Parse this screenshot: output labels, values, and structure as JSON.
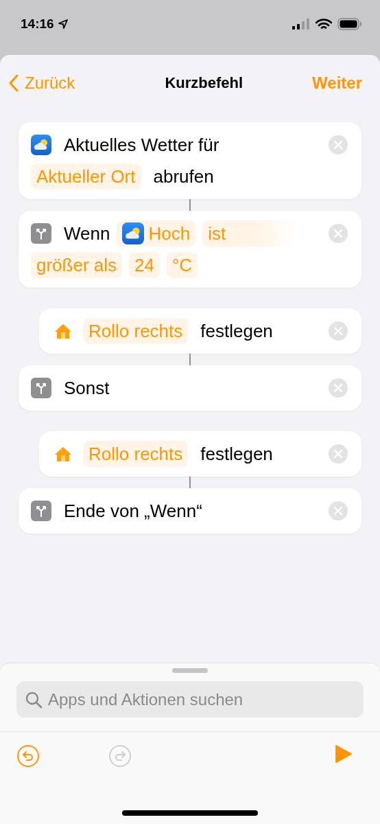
{
  "status_bar": {
    "time": "14:16"
  },
  "nav": {
    "back": "Zurück",
    "title": "Kurzbefehl",
    "next": "Weiter"
  },
  "actions": [
    {
      "kind": "weather",
      "parts": [
        {
          "kind": "word",
          "text": "Aktuelles Wetter für"
        },
        {
          "kind": "token",
          "text": "Aktueller Ort"
        },
        {
          "kind": "word",
          "text": "abrufen"
        }
      ]
    },
    {
      "kind": "if",
      "parts": [
        {
          "kind": "word",
          "text": "Wenn"
        },
        {
          "kind": "weather-token",
          "text": "Hoch"
        },
        {
          "kind": "fading-token",
          "text": "ist"
        },
        {
          "kind": "token",
          "text": "größer als"
        },
        {
          "kind": "token",
          "text": "24"
        },
        {
          "kind": "token",
          "text": "°C"
        }
      ],
      "children": [
        {
          "kind": "home",
          "parts": [
            {
              "kind": "token",
              "text": "Rollo rechts"
            },
            {
              "kind": "word",
              "text": "festlegen"
            }
          ]
        }
      ]
    },
    {
      "kind": "if",
      "parts": [
        {
          "kind": "word",
          "text": "Sonst"
        }
      ],
      "children": [
        {
          "kind": "home",
          "parts": [
            {
              "kind": "token",
              "text": "Rollo rechts"
            },
            {
              "kind": "word",
              "text": "festlegen"
            }
          ]
        }
      ]
    },
    {
      "kind": "if",
      "parts": [
        {
          "kind": "word",
          "text": "Ende von „Wenn“"
        }
      ]
    }
  ],
  "search": {
    "placeholder": "Apps und Aktionen suchen"
  },
  "toolbar": {
    "undo": {
      "disabled": false
    },
    "redo": {
      "disabled": true
    }
  }
}
